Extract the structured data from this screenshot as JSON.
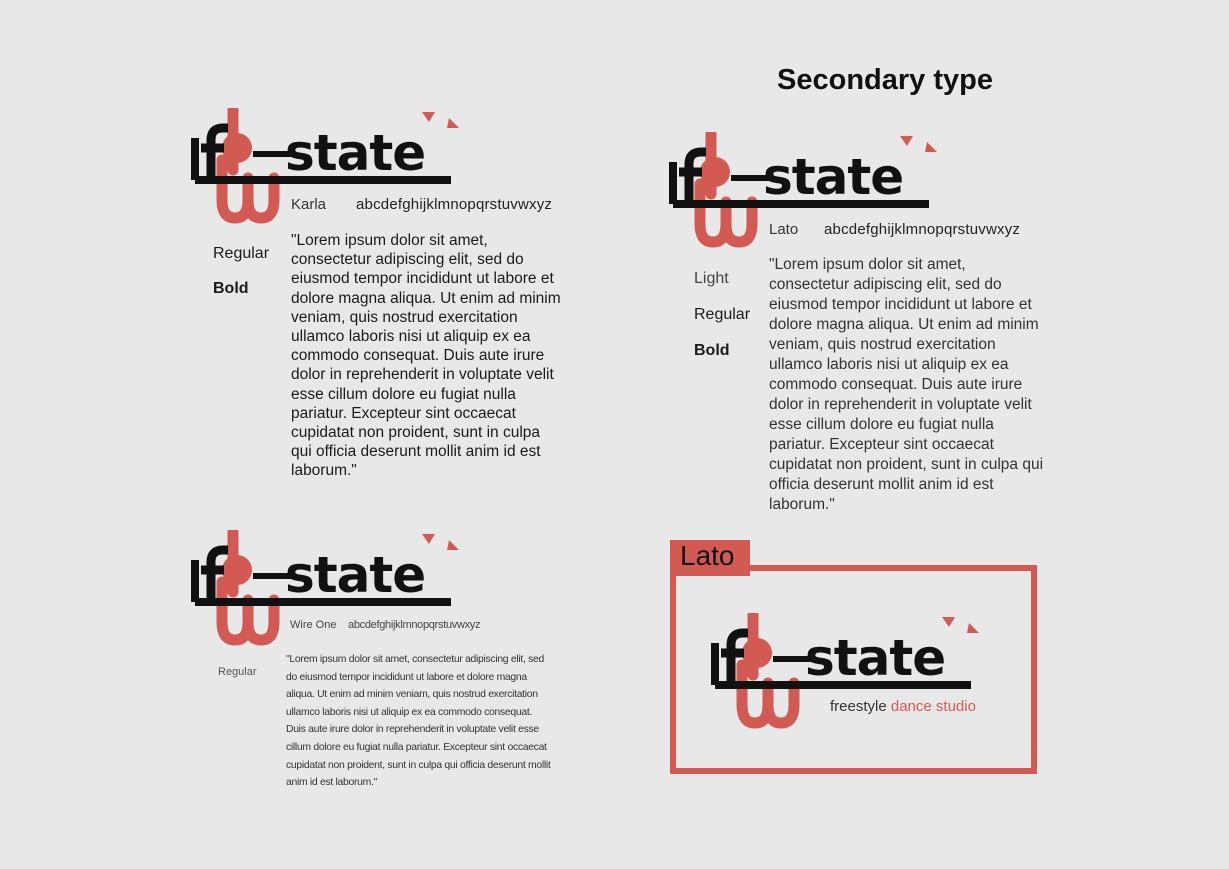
{
  "title": "Secondary type",
  "logo": {
    "wordmark": "flo state",
    "colors": {
      "accent": "#d35a52",
      "ink": "#111111"
    }
  },
  "panels": [
    {
      "font_name": "Karla",
      "alphabet": "abcdefghijklmnopqrstuvwxyz",
      "weights": [
        "Regular",
        "Bold"
      ],
      "sample": "\"Lorem ipsum dolor sit amet, consectetur adipiscing elit, sed do eiusmod tempor incididunt ut labore et dolore magna aliqua. Ut enim ad minim veniam, quis nostrud exercitation ullamco laboris nisi ut aliquip ex ea commodo consequat. Duis aute irure dolor in reprehenderit in voluptate velit esse cillum dolore eu fugiat nulla pariatur. Excepteur sint occaecat cupidatat non proident, sunt in culpa qui officia deserunt mollit anim id est laborum.\""
    },
    {
      "font_name": "Lato",
      "alphabet": "abcdefghijklmnopqrstuvwxyz",
      "weights": [
        "Light",
        "Regular",
        "Bold"
      ],
      "sample": "\"Lorem ipsum dolor sit amet, consectetur adipiscing elit, sed do eiusmod tempor incididunt ut labore et dolore magna aliqua. Ut enim ad minim veniam, quis nostrud exercitation ullamco laboris nisi ut aliquip ex ea commodo consequat. Duis aute irure dolor in reprehenderit in voluptate velit esse cillum dolore eu fugiat nulla pariatur. Excepteur sint occaecat cupidatat non proident, sunt in culpa qui officia deserunt mollit anim id est laborum.\""
    },
    {
      "font_name": "Wire One",
      "alphabet": "abcdefghijklmnopqrstuvwxyz",
      "weights": [
        "Regular"
      ],
      "sample": "\"Lorem ipsum dolor sit amet, consectetur adipiscing elit, sed do eiusmod tempor incididunt ut labore et dolore magna aliqua. Ut enim ad minim veniam, quis nostrud exercitation ullamco laboris nisi ut aliquip ex ea commodo consequat. Duis aute irure dolor in reprehenderit in voluptate velit esse cillum dolore eu fugiat nulla pariatur. Excepteur sint occaecat cupidatat non proident, sunt in culpa qui officia deserunt mollit anim id est laborum.\""
    }
  ],
  "lockup": {
    "label": "Lato",
    "tagline_part1": "freestyle",
    "tagline_part2": "dance studio",
    "frame_color": "#d35a52"
  }
}
